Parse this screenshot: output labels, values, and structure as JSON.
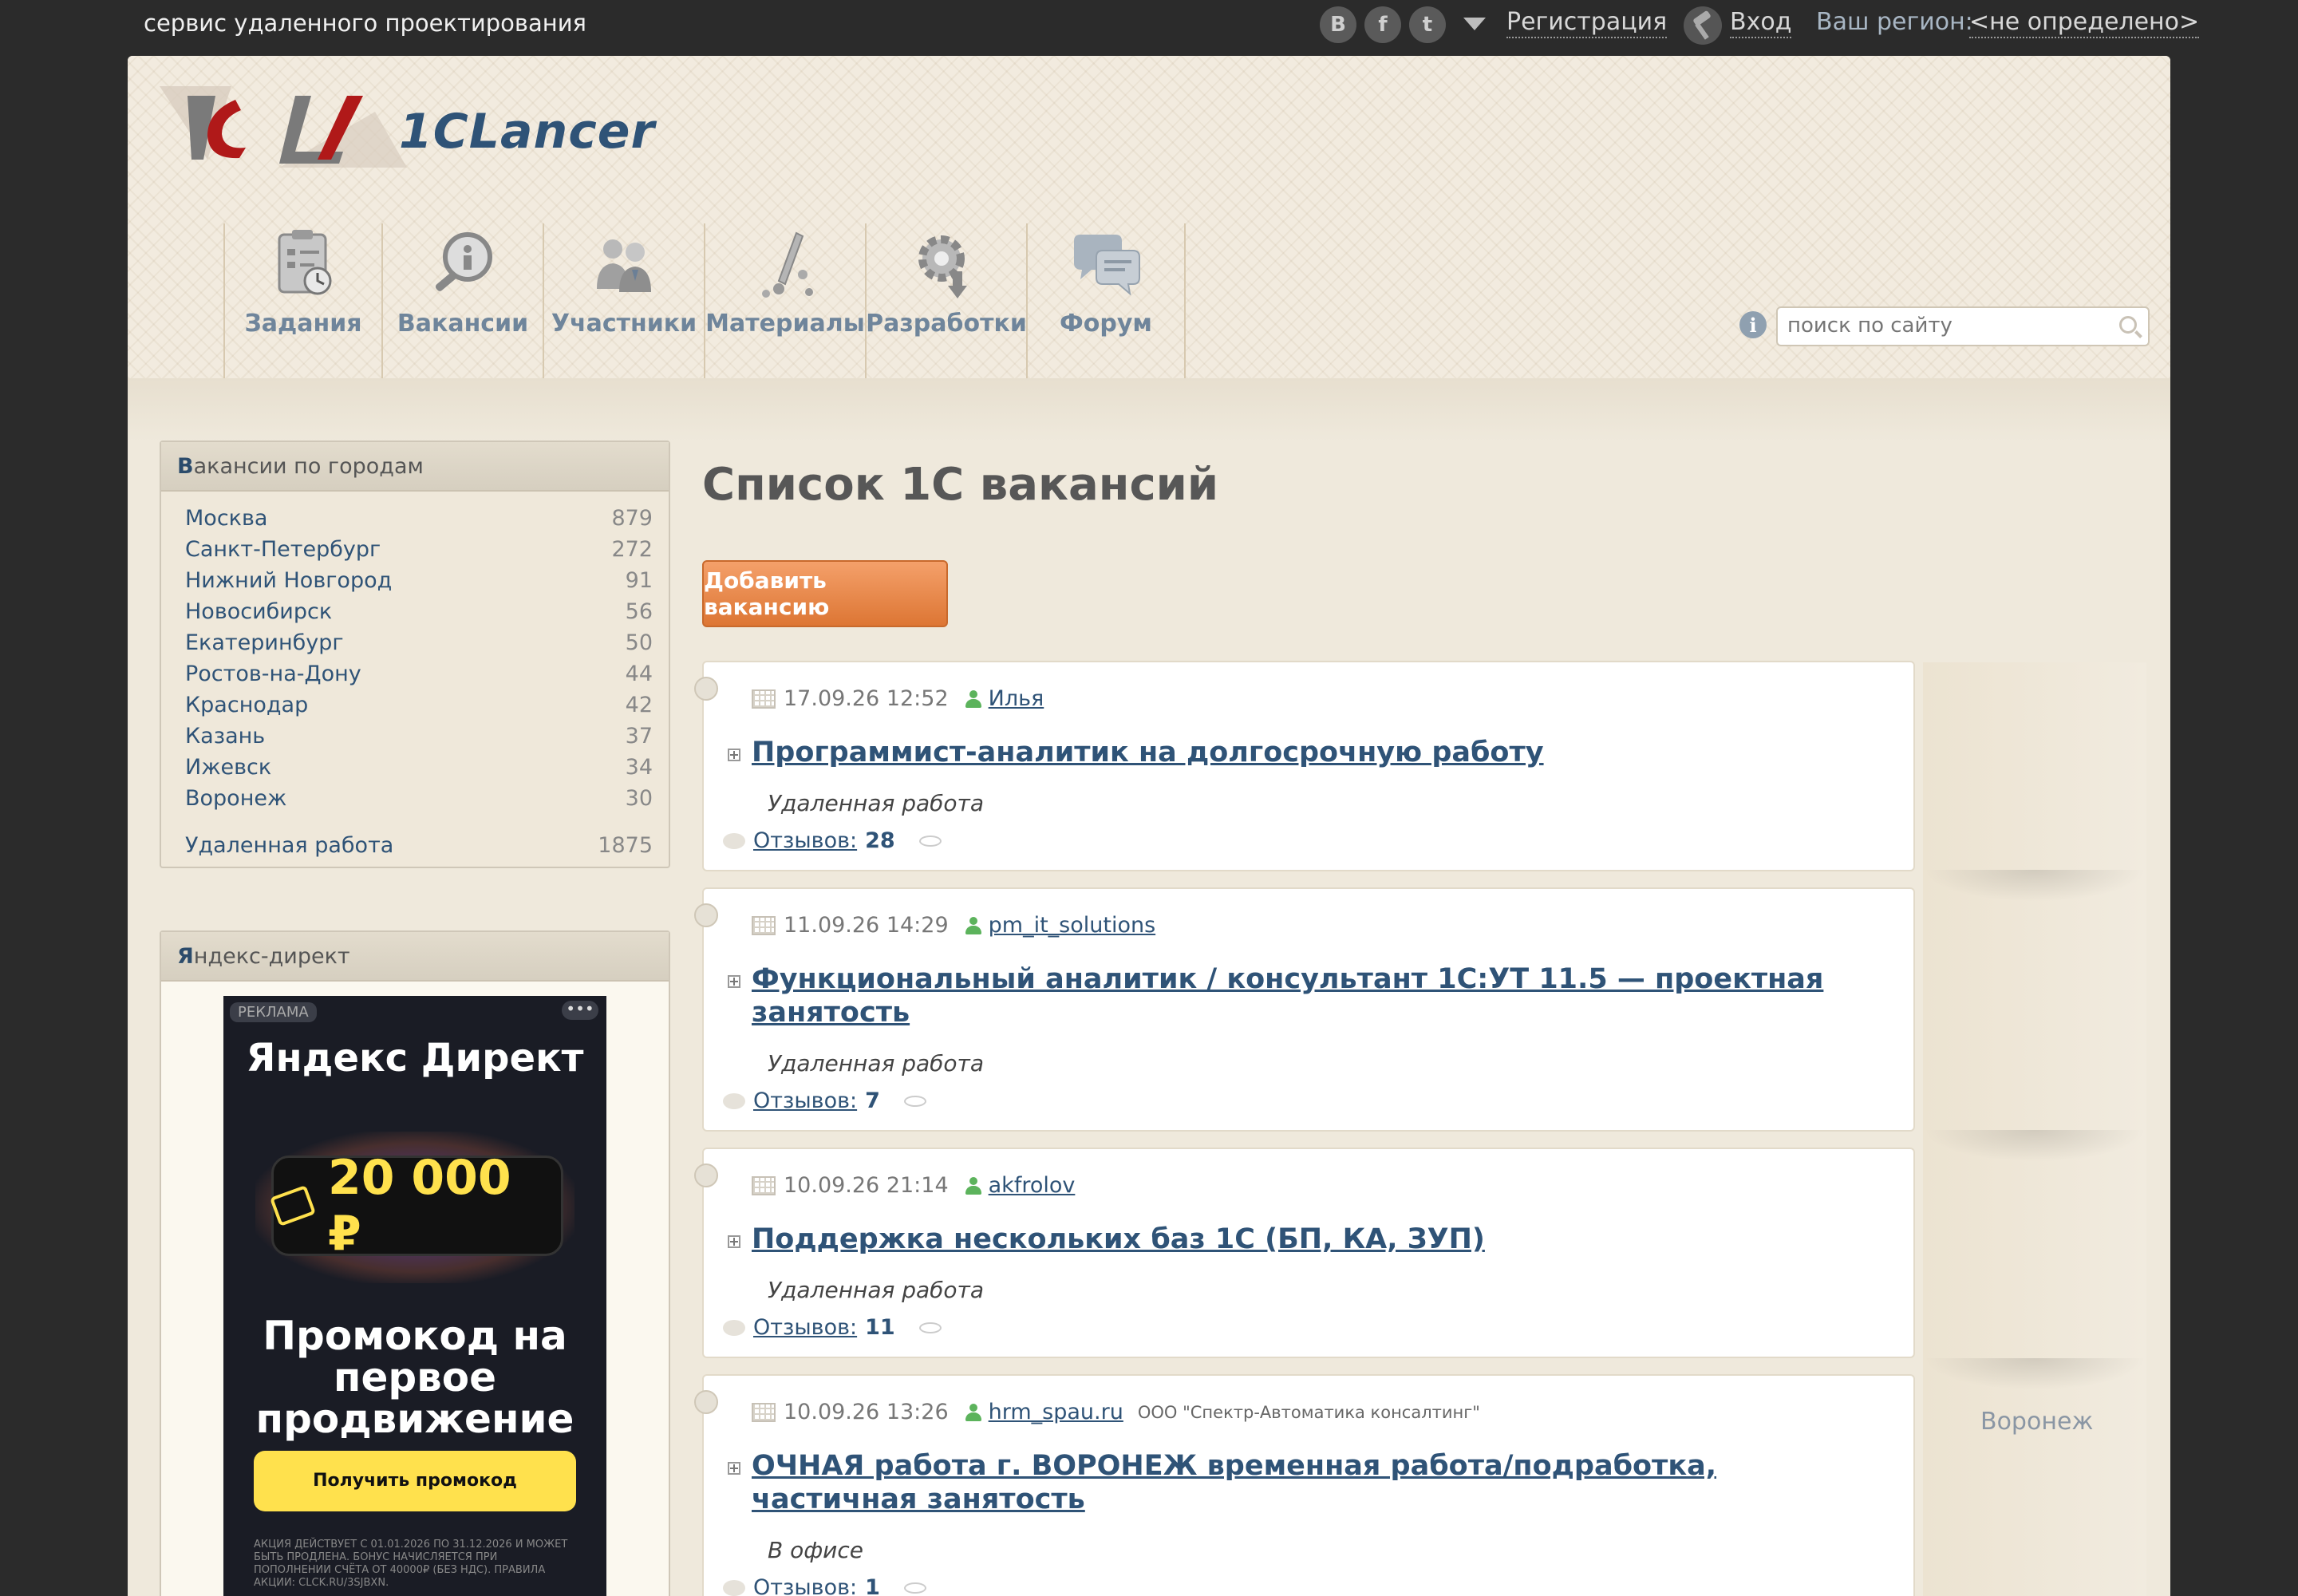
{
  "topbar": {
    "tagline": "сервис удаленного проектирования",
    "social": [
      "B",
      "f",
      "t"
    ],
    "register": "Регистрация",
    "login": "Вход",
    "region_label": "Ваш регион:",
    "region_value": "<не определено>"
  },
  "logo": {
    "text": "1CLancer"
  },
  "nav": [
    {
      "label": "Задания",
      "icon": "tasks-clipboard-icon"
    },
    {
      "label": "Вакансии",
      "icon": "vacancies-magnifier-icon"
    },
    {
      "label": "Участники",
      "icon": "participants-icon"
    },
    {
      "label": "Материалы",
      "icon": "materials-icon"
    },
    {
      "label": "Разработки",
      "icon": "developments-gear-icon"
    },
    {
      "label": "Форум",
      "icon": "forum-chat-icon"
    }
  ],
  "search": {
    "placeholder": "поиск по сайту"
  },
  "cities_box": {
    "title_first": "В",
    "title_rest": "акансии по городам",
    "cities": [
      {
        "name": "Москва",
        "count": "879"
      },
      {
        "name": "Санкт-Петербург",
        "count": "272"
      },
      {
        "name": "Нижний Новгород",
        "count": "91"
      },
      {
        "name": "Новосибирск",
        "count": "56"
      },
      {
        "name": "Екатеринбург",
        "count": "50"
      },
      {
        "name": "Ростов-на-Дону",
        "count": "44"
      },
      {
        "name": "Краснодар",
        "count": "42"
      },
      {
        "name": "Казань",
        "count": "37"
      },
      {
        "name": "Ижевск",
        "count": "34"
      },
      {
        "name": "Воронеж",
        "count": "30"
      }
    ],
    "remote": {
      "name": "Удаленная работа",
      "count": "1875"
    }
  },
  "ad_box": {
    "title_first": "Я",
    "title_rest": "ндекс-директ",
    "badge": "РЕКЛАМА",
    "dots": "•••",
    "brand": "Яндекс Директ",
    "price": "20 000 ₽",
    "promo": "Промокод на первое продвижение",
    "button": "Получить промокод",
    "small": "АКЦИЯ ДЕЙСТВУЕТ С 01.01.2026 ПО 31.12.2026 И МОЖЕТ БЫТЬ ПРОДЛЕНА. БОНУС НАЧИСЛЯЕТСЯ ПРИ ПОПОЛНЕНИИ СЧЁТА ОТ 40000₽ (БЕЗ НДС). ПРАВИЛА АКЦИИ: CLCK.RU/3SJBXN."
  },
  "main": {
    "title": "Список 1С вакансий",
    "add_button": "Добавить вакансию",
    "side_city": "Воронеж",
    "vacancies": [
      {
        "date": "17.09.26 12:52",
        "author": "Илья",
        "company": "",
        "title": "Программист-аналитик на долгосрочную работу",
        "work_type": "Удаленная работа",
        "reviews_label": "Отзывов:",
        "reviews": "28"
      },
      {
        "date": "11.09.26 14:29",
        "author": "pm_it_solutions",
        "company": "",
        "title": "Функциональный аналитик / консультант 1С:УТ 11.5 — проектная занятость",
        "work_type": "Удаленная работа",
        "reviews_label": "Отзывов:",
        "reviews": "7"
      },
      {
        "date": "10.09.26 21:14",
        "author": "akfrolov",
        "company": "",
        "title": "Поддержка нескольких баз 1С (БП, КА, ЗУП)",
        "work_type": "Удаленная работа",
        "reviews_label": "Отзывов:",
        "reviews": "11"
      },
      {
        "date": "10.09.26 13:26",
        "author": "hrm_spau.ru",
        "company": "ООО \"Спектр-Автоматика консалтинг\"",
        "title": "ОЧНАЯ работа г. ВОРОНЕЖ временная работа/подработка, частичная занятость",
        "work_type": "В офисе",
        "reviews_label": "Отзывов:",
        "reviews": "1"
      }
    ]
  }
}
